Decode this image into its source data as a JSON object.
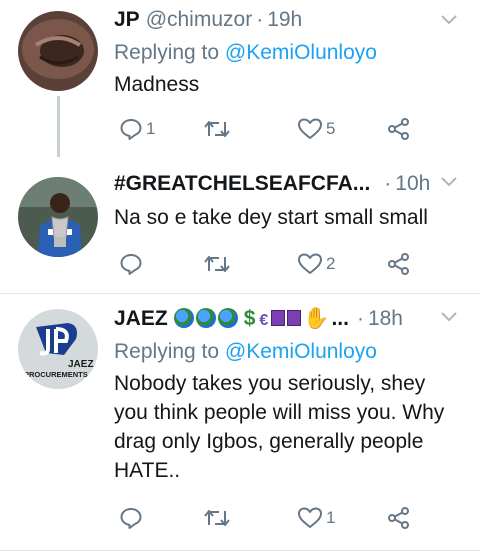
{
  "tweets": [
    {
      "name": "JP",
      "handle": "@chimuzor",
      "separator": "·",
      "time": "19h",
      "reply_prefix": "Replying to",
      "reply_to": "@KemiOlunloyo",
      "text": "Madness",
      "reply_count": "1",
      "retweet_count": "",
      "like_count": "5"
    },
    {
      "name": "#GREATCHELSEAFCFA...",
      "separator": "·",
      "time": "10h",
      "text": "Na so e take dey start small small",
      "reply_count": "",
      "retweet_count": "",
      "like_count": "2"
    },
    {
      "name": "JAEZ",
      "name_suffix": "...",
      "separator": "·",
      "time": "18h",
      "reply_prefix": "Replying to",
      "reply_to": "@KemiOlunloyo",
      "text": "Nobody takes you seriously, shey you think people will miss you. Why drag only Igbos, generally people HATE..",
      "reply_count": "",
      "retweet_count": "",
      "like_count": "1",
      "avatar_logo_text": "JAEZ",
      "avatar_logo_sub": "PROCUREMENTS"
    }
  ],
  "colors": {
    "accent": "#1da1f2",
    "muted": "#657786",
    "text": "#14171a",
    "divider": "#e1e8ed"
  },
  "icons": [
    "reply-icon",
    "retweet-icon",
    "like-icon",
    "share-icon",
    "chevron-down-icon"
  ]
}
